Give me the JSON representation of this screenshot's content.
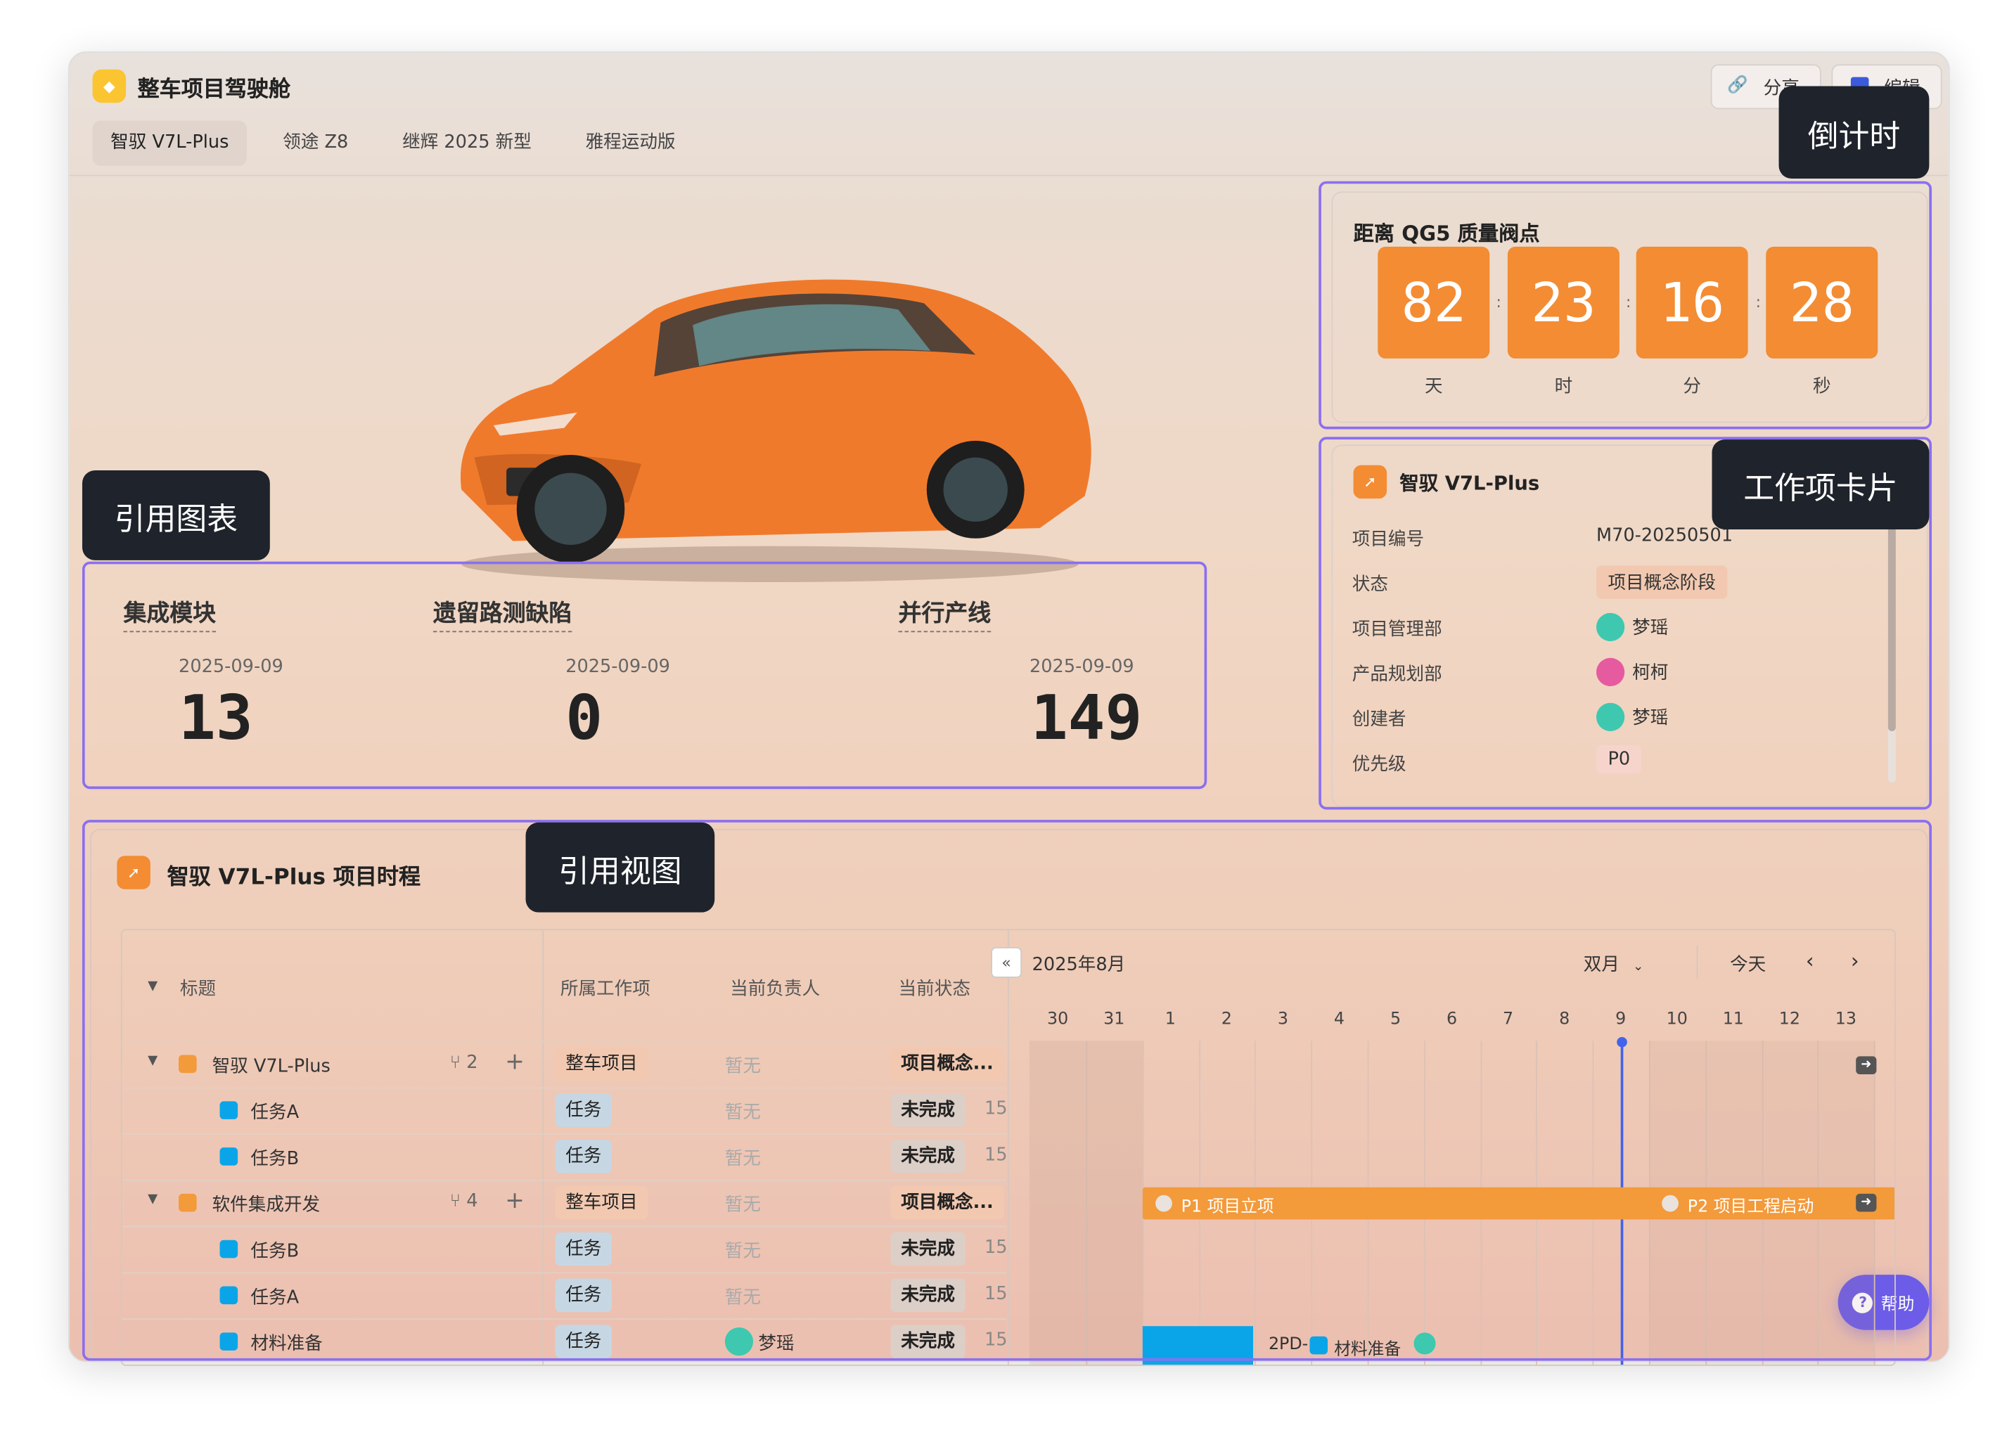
{
  "app": {
    "title": "整车项目驾驶舱",
    "share_label": "分享",
    "edit_label": "编辑"
  },
  "tabs": [
    "智驭 V7L-Plus",
    "领途 Z8",
    "继辉 2025 新型",
    "雅程运动版"
  ],
  "callouts": {
    "countdown": "倒计时",
    "chart": "引用图表",
    "card": "工作项卡片",
    "view": "引用视图"
  },
  "countdown": {
    "title": "距离 QG5 质量阀点",
    "values": [
      "82",
      "23",
      "16",
      "28"
    ],
    "units": [
      "天",
      "时",
      "分",
      "秒"
    ],
    "sep": ":"
  },
  "metrics": [
    {
      "title": "集成模块",
      "date": "2025-09-09",
      "value": "13"
    },
    {
      "title": "遗留路测缺陷",
      "date": "2025-09-09",
      "value": "0"
    },
    {
      "title": "并行产线",
      "date": "2025-09-09",
      "value": "149"
    }
  ],
  "card": {
    "title": "智驭 V7L-Plus",
    "fields": [
      {
        "label": "项目编号",
        "value": "M70-20250501"
      },
      {
        "label": "状态",
        "value": "项目概念阶段"
      },
      {
        "label": "项目管理部",
        "value": "梦瑶"
      },
      {
        "label": "产品规划部",
        "value": "柯柯"
      },
      {
        "label": "创建者",
        "value": "梦瑶"
      },
      {
        "label": "优先级",
        "value": "P0"
      }
    ]
  },
  "view": {
    "title": "智驭 V7L-Plus 项目时程",
    "columns": [
      "标题",
      "所属工作项",
      "当前负责人",
      "当前状态"
    ],
    "month": "2025年8月",
    "range": "双月",
    "today": "今天",
    "days": [
      "30",
      "31",
      "1",
      "2",
      "3",
      "4",
      "5",
      "6",
      "7",
      "8",
      "9",
      "10",
      "11",
      "12",
      "13"
    ],
    "rows": [
      {
        "title": "智驭 V7L-Plus",
        "type": "整车项目",
        "owner": "暂无",
        "status": "项目概念...",
        "extra": "",
        "children": "2"
      },
      {
        "title": "任务A",
        "type": "任务",
        "owner": "暂无",
        "status": "未完成",
        "extra": "15",
        "children": ""
      },
      {
        "title": "任务B",
        "type": "任务",
        "owner": "暂无",
        "status": "未完成",
        "extra": "15",
        "children": ""
      },
      {
        "title": "软件集成开发",
        "type": "整车项目",
        "owner": "暂无",
        "status": "项目概念...",
        "extra": "",
        "children": "4"
      },
      {
        "title": "任务B",
        "type": "任务",
        "owner": "暂无",
        "status": "未完成",
        "extra": "15",
        "children": ""
      },
      {
        "title": "任务A",
        "type": "任务",
        "owner": "暂无",
        "status": "未完成",
        "extra": "15",
        "children": ""
      },
      {
        "title": "材料准备",
        "type": "任务",
        "owner": "梦瑶",
        "status": "未完成",
        "extra": "15",
        "children": ""
      }
    ],
    "bars": {
      "milestone1": "P1 项目立项",
      "milestone2": "P2 项目工程启动",
      "task_label": "2PD-",
      "task_name": "材料准备"
    }
  },
  "help": {
    "label": "帮助"
  }
}
